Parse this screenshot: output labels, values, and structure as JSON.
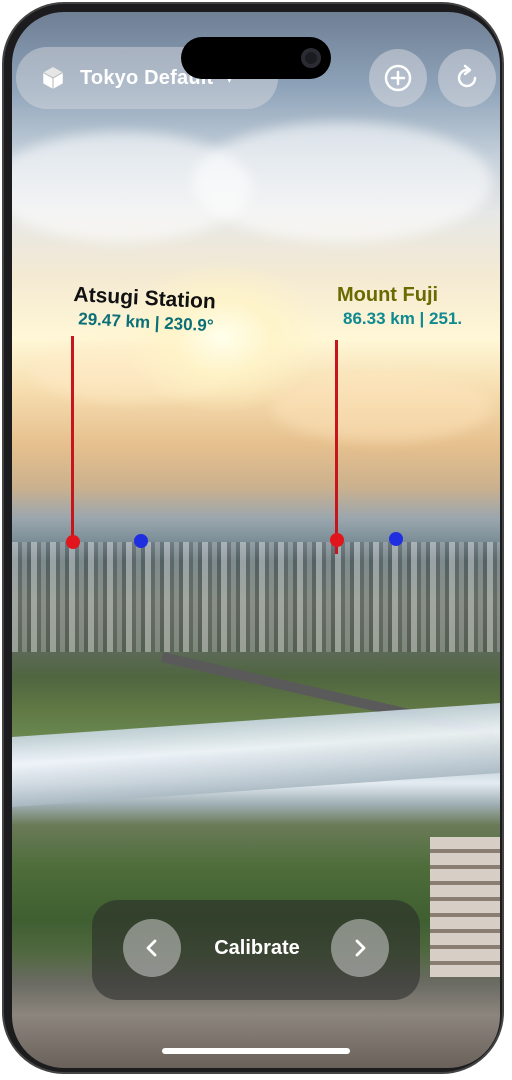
{
  "app": {
    "preset_title": "Tokyo Default",
    "preset_icon": "cube-icon",
    "add_icon": "plus-circle-icon",
    "refresh_icon": "refresh-icon"
  },
  "pois": [
    {
      "name": "Atsugi Station",
      "distance_bearing": "29.47 km | 230.9°",
      "name_color": "#111111",
      "distance_color": "#0b6f77"
    },
    {
      "name": "Mount Fuji",
      "distance_bearing": "86.33 km | 251.",
      "name_color": "#6b6a00",
      "distance_color": "#0e8a90"
    }
  ],
  "bottom_bar": {
    "prev_icon": "chevron-left-icon",
    "label": "Calibrate",
    "next_icon": "chevron-right-icon"
  },
  "colors": {
    "marker_red": "#e0161c",
    "marker_blue": "#1f2fe0",
    "poi_line": "#c4161c"
  }
}
